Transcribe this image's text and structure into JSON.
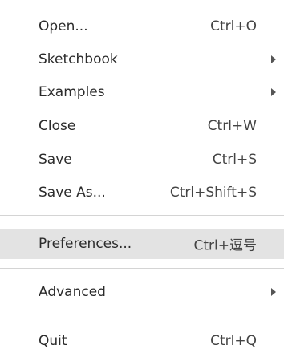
{
  "menu": {
    "items": [
      {
        "label": "Open...",
        "shortcut": "Ctrl+O"
      },
      {
        "label": "Sketchbook",
        "submenu": true
      },
      {
        "label": "Examples",
        "submenu": true
      },
      {
        "label": "Close",
        "shortcut": "Ctrl+W"
      },
      {
        "label": "Save",
        "shortcut": "Ctrl+S"
      },
      {
        "label": "Save As...",
        "shortcut": "Ctrl+Shift+S"
      },
      {
        "label": "Preferences...",
        "shortcut": "Ctrl+逗号",
        "highlighted": true
      },
      {
        "label": "Advanced",
        "submenu": true
      },
      {
        "label": "Quit",
        "shortcut": "Ctrl+Q"
      }
    ],
    "submenu_icon": "chevron-right-icon",
    "highlight_color": "#e3e3e3"
  }
}
